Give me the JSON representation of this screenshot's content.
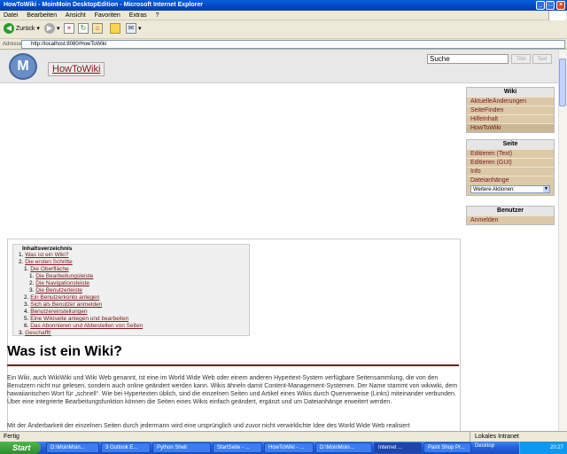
{
  "window": {
    "title": "HowToWiki - MoinMoin DesktopEdition - Microsoft Internet Explorer"
  },
  "menu": [
    "Datei",
    "Bearbeiten",
    "Ansicht",
    "Favoriten",
    "Extras",
    "?"
  ],
  "toolbar": {
    "back_label": "Zurück"
  },
  "address": {
    "label": "Adresse",
    "url": "http://localhost:8080/HowToWiki"
  },
  "wiki": {
    "page_title": "HowToWiki",
    "search_placeholder": "Suche",
    "title_button": "Titel",
    "text_button": "Text",
    "sidebar": {
      "wiki_header": "Wiki",
      "wiki_items": [
        "AktuelleÄnderungen",
        "SeiteFinden",
        "HilfeInhalt",
        "HowToWiki"
      ],
      "page_header": "Seite",
      "page_items": [
        "Editieren (Text)",
        "Editieren (GUI)",
        "Info",
        "Dateianhänge"
      ],
      "more_actions": "Weitere Aktionen:",
      "user_header": "Benutzer",
      "user_items": [
        "Anmelden"
      ]
    },
    "toc": {
      "title": "Inhaltsverzeichnis",
      "items": [
        {
          "num": "1.",
          "text": "Was ist ein Wiki?"
        },
        {
          "num": "2.",
          "text": "Die ersten Schritte"
        },
        {
          "num": "1.",
          "text": "Die Oberfläche"
        },
        {
          "num": "1.",
          "text": "Die Bearbeitungsleiste"
        },
        {
          "num": "2.",
          "text": "Die Navigationsleiste"
        },
        {
          "num": "3.",
          "text": "Die Benutzerleiste"
        },
        {
          "num": "2.",
          "text": "Ein Benutzerkonto anlegen"
        },
        {
          "num": "3.",
          "text": "Sich als Benutzer anmelden"
        },
        {
          "num": "4.",
          "text": "Benutzereinstellungen"
        },
        {
          "num": "5.",
          "text": "Eine Wikiseite anlegen und bearbeiten"
        },
        {
          "num": "6.",
          "text": "Das Abonnieren und Abbestellen von Seiten"
        },
        {
          "num": "3.",
          "text": "Geschafft!"
        }
      ]
    },
    "heading": "Was ist ein Wiki?",
    "paragraph1": "Ein Wiki, auch WikiWiki und Wiki Web genannt, ist eine im World Wide Web oder einem anderen Hypertext-System verfügbare Seitensammlung, die von den Benutzern nicht nur gelesen, sondern auch online geändert werden kann. Wikis ähneln damit Content-Management-Systemen. Der Name stammt von wikiwiki, dem hawaiianischen Wort für „schnell“. Wie bei Hypertexten üblich, sind die einzelnen Seiten und Artikel eines Wikis durch Querverweise (Links) miteinander verbunden. Über eine integrierte Bearbeitungsfunktion können die Seiten eines Wikis einfach geändert, ergänzt und um Dateianhänge erweitert werden.",
    "paragraph2": "Mit der Änderbarkeit der einzelnen Seiten durch jedermann wird eine ursprünglich und zuvor nicht verwirklichte Idee des World Wide Web realisiert"
  },
  "status": {
    "left": "Fertig",
    "zone": "Lokales Intranet"
  },
  "taskbar": {
    "start": "Start",
    "tasks": [
      "D:\\MoinMoin...",
      "3 Outlook E...",
      "Python Shell",
      "StartSeite - ...",
      "HowToWiki - ...",
      "D:\\MoinMoin...",
      "Internet ...",
      "Paint Shop Pr..."
    ],
    "desktop": "Desktop",
    "clock": "20:27"
  }
}
